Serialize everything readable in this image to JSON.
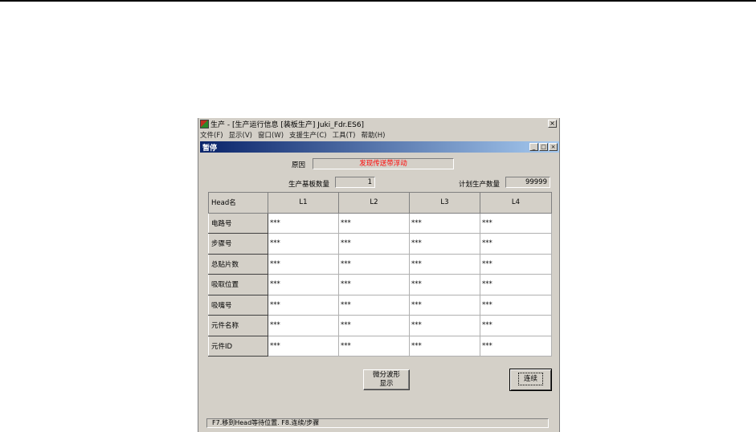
{
  "window": {
    "title": "生产 - [生产运行信息 [装板生产] Juki_Fdr.ES6]",
    "close_glyph": "×"
  },
  "menu": [
    {
      "label": "文件(F)"
    },
    {
      "label": "显示(V)"
    },
    {
      "label": "窗口(W)"
    },
    {
      "label": "支援生产(C)"
    },
    {
      "label": "工具(T)"
    },
    {
      "label": "帮助(H)"
    }
  ],
  "child": {
    "title": "暂停",
    "buttons": [
      "_",
      "□",
      "×"
    ]
  },
  "status": {
    "cause_label": "原因",
    "cause_value": "发现传送带浮动",
    "cause_color": "#ff0000",
    "boards_label": "生产基板数量",
    "boards_value": "1",
    "plan_label": "计划生产数量",
    "plan_value": "99999"
  },
  "table": {
    "corner": "Head名",
    "columns": [
      "L1",
      "L2",
      "L3",
      "L4"
    ],
    "rows": [
      {
        "label": "电路号",
        "cells": [
          "***",
          "***",
          "***",
          "***"
        ]
      },
      {
        "label": "步骤号",
        "cells": [
          "***",
          "***",
          "***",
          "***"
        ]
      },
      {
        "label": "总贴片数",
        "cells": [
          "***",
          "***",
          "***",
          "***"
        ]
      },
      {
        "label": "吸取位置",
        "cells": [
          "***",
          "***",
          "***",
          "***"
        ]
      },
      {
        "label": "吸嘴号",
        "cells": [
          "***",
          "***",
          "***",
          "***"
        ]
      },
      {
        "label": "元件名称",
        "cells": [
          "***",
          "***",
          "***",
          "***"
        ]
      },
      {
        "label": "元件ID",
        "cells": [
          "***",
          "***",
          "***",
          "***"
        ]
      }
    ]
  },
  "buttons": {
    "waveform": "微分波形\n显示",
    "continue": "连续"
  },
  "statusbar": {
    "text": "F7.移到Head等待位置.   F8.连续/步骤"
  },
  "colors": {
    "face": "#d4d0c8",
    "title_gradient_start": "#0a246a",
    "title_gradient_end": "#a6caf0"
  }
}
